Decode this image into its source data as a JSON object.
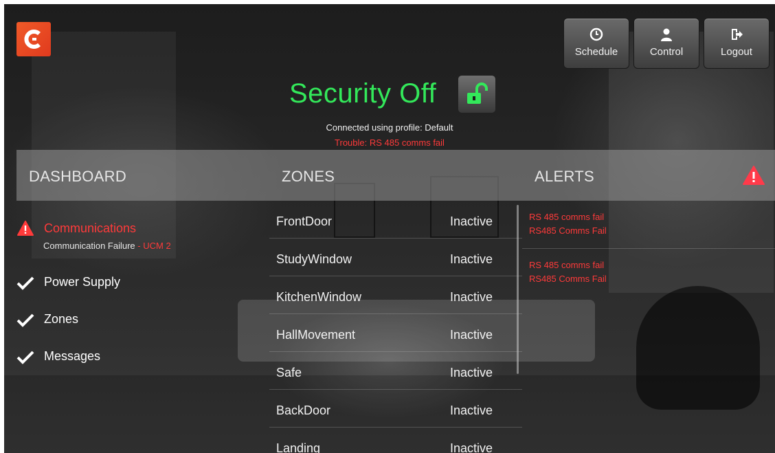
{
  "colors": {
    "brand": "#f05a28",
    "secure_off": "#33e85a",
    "trouble": "#ff3a3a"
  },
  "logo": {
    "letter": "C",
    "icon": "app-logo-icon"
  },
  "toolbar": {
    "schedule_label": "Schedule",
    "control_label": "Control",
    "logout_label": "Logout",
    "schedule_icon": "clock-icon",
    "control_icon": "user-icon",
    "logout_icon": "logout-icon"
  },
  "status": {
    "security_text": "Security Off",
    "lock_icon": "unlock-icon",
    "connection": "Connected using profile: Default",
    "trouble": "Trouble: RS 485 comms fail"
  },
  "sections": {
    "dashboard": "DASHBOARD",
    "zones": "ZONES",
    "alerts": "ALERTS"
  },
  "dashboard": {
    "communications": {
      "label": "Communications",
      "detail": "Communication Failure",
      "detail_separator": " - ",
      "detail_device": "UCM 2",
      "icon": "warning-icon"
    },
    "items": [
      {
        "label": "Power Supply",
        "icon": "check-icon"
      },
      {
        "label": "Zones",
        "icon": "check-icon"
      },
      {
        "label": "Messages",
        "icon": "check-icon"
      }
    ]
  },
  "zones": [
    {
      "name": "FrontDoor",
      "status": "Inactive"
    },
    {
      "name": "StudyWindow",
      "status": "Inactive"
    },
    {
      "name": "KitchenWindow",
      "status": "Inactive"
    },
    {
      "name": "HallMovement",
      "status": "Inactive"
    },
    {
      "name": "Safe",
      "status": "Inactive"
    },
    {
      "name": "BackDoor",
      "status": "Inactive"
    },
    {
      "name": "Landing",
      "status": "Inactive"
    }
  ],
  "alerts": [
    {
      "line1": "RS 485 comms fail",
      "line2": "RS485 Comms Fail"
    },
    {
      "line1": "RS 485 comms fail",
      "line2": "RS485 Comms Fail"
    }
  ]
}
